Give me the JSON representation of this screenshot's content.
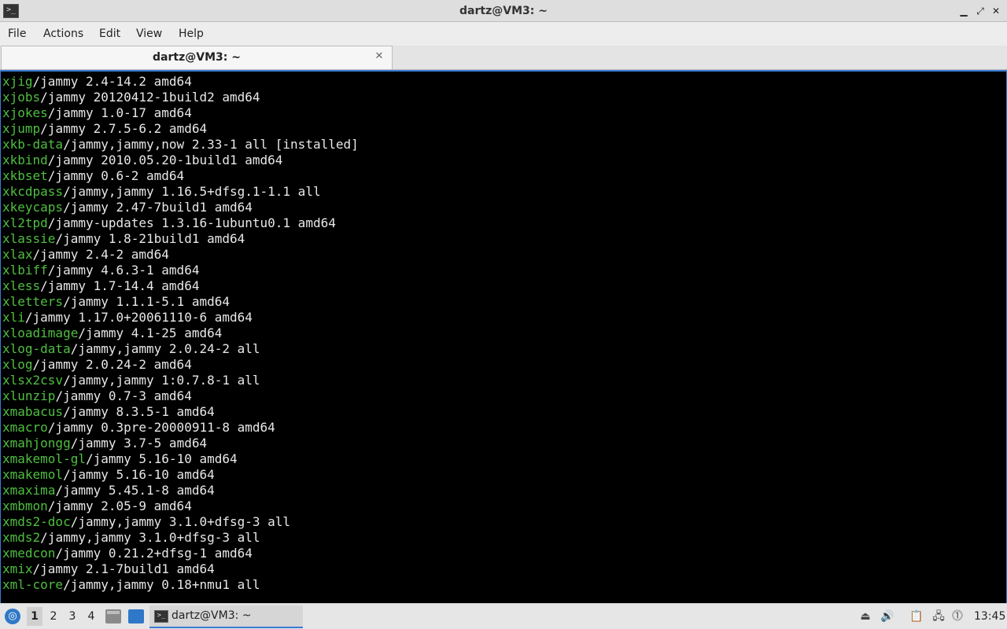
{
  "window": {
    "title": "dartz@VM3: ~",
    "app_icon": "terminal-icon",
    "controls": [
      "minimize",
      "maximize",
      "close"
    ]
  },
  "menu": [
    "File",
    "Actions",
    "Edit",
    "View",
    "Help"
  ],
  "tab": {
    "label": "dartz@VM3: ~"
  },
  "terminal": {
    "lines": [
      {
        "pkg": "xjig",
        "rest": "/jammy 2.4-14.2 amd64"
      },
      {
        "pkg": "xjobs",
        "rest": "/jammy 20120412-1build2 amd64"
      },
      {
        "pkg": "xjokes",
        "rest": "/jammy 1.0-17 amd64"
      },
      {
        "pkg": "xjump",
        "rest": "/jammy 2.7.5-6.2 amd64"
      },
      {
        "pkg": "xkb-data",
        "rest": "/jammy,jammy,now 2.33-1 all [installed]"
      },
      {
        "pkg": "xkbind",
        "rest": "/jammy 2010.05.20-1build1 amd64"
      },
      {
        "pkg": "xkbset",
        "rest": "/jammy 0.6-2 amd64"
      },
      {
        "pkg": "xkcdpass",
        "rest": "/jammy,jammy 1.16.5+dfsg.1-1.1 all"
      },
      {
        "pkg": "xkeycaps",
        "rest": "/jammy 2.47-7build1 amd64"
      },
      {
        "pkg": "xl2tpd",
        "rest": "/jammy-updates 1.3.16-1ubuntu0.1 amd64"
      },
      {
        "pkg": "xlassie",
        "rest": "/jammy 1.8-21build1 amd64"
      },
      {
        "pkg": "xlax",
        "rest": "/jammy 2.4-2 amd64"
      },
      {
        "pkg": "xlbiff",
        "rest": "/jammy 4.6.3-1 amd64"
      },
      {
        "pkg": "xless",
        "rest": "/jammy 1.7-14.4 amd64"
      },
      {
        "pkg": "xletters",
        "rest": "/jammy 1.1.1-5.1 amd64"
      },
      {
        "pkg": "xli",
        "rest": "/jammy 1.17.0+20061110-6 amd64"
      },
      {
        "pkg": "xloadimage",
        "rest": "/jammy 4.1-25 amd64"
      },
      {
        "pkg": "xlog-data",
        "rest": "/jammy,jammy 2.0.24-2 all"
      },
      {
        "pkg": "xlog",
        "rest": "/jammy 2.0.24-2 amd64"
      },
      {
        "pkg": "xlsx2csv",
        "rest": "/jammy,jammy 1:0.7.8-1 all"
      },
      {
        "pkg": "xlunzip",
        "rest": "/jammy 0.7-3 amd64"
      },
      {
        "pkg": "xmabacus",
        "rest": "/jammy 8.3.5-1 amd64"
      },
      {
        "pkg": "xmacro",
        "rest": "/jammy 0.3pre-20000911-8 amd64"
      },
      {
        "pkg": "xmahjongg",
        "rest": "/jammy 3.7-5 amd64"
      },
      {
        "pkg": "xmakemol-gl",
        "rest": "/jammy 5.16-10 amd64"
      },
      {
        "pkg": "xmakemol",
        "rest": "/jammy 5.16-10 amd64"
      },
      {
        "pkg": "xmaxima",
        "rest": "/jammy 5.45.1-8 amd64"
      },
      {
        "pkg": "xmbmon",
        "rest": "/jammy 2.05-9 amd64"
      },
      {
        "pkg": "xmds2-doc",
        "rest": "/jammy,jammy 3.1.0+dfsg-3 all"
      },
      {
        "pkg": "xmds2",
        "rest": "/jammy,jammy 3.1.0+dfsg-3 all"
      },
      {
        "pkg": "xmedcon",
        "rest": "/jammy 0.21.2+dfsg-1 amd64"
      },
      {
        "pkg": "xmix",
        "rest": "/jammy 2.1-7build1 amd64"
      },
      {
        "pkg": "xml-core",
        "rest": "/jammy,jammy 0.18+nmu1 all"
      }
    ]
  },
  "taskbar": {
    "start_icon": "lubuntu-start-icon",
    "workspaces": [
      "1",
      "2",
      "3",
      "4"
    ],
    "active_workspace": "1",
    "task_label": "dartz@VM3: ~",
    "tray_icons": [
      "eject-icon",
      "volume-icon",
      "clipboard-icon",
      "network-icon",
      "update-notifier-icon"
    ],
    "clock": "13:45"
  },
  "colors": {
    "package_name": "#4fbf40",
    "terminal_bg": "#000000",
    "terminal_fg": "#e8e8e8",
    "accent": "#3a7bd5"
  }
}
